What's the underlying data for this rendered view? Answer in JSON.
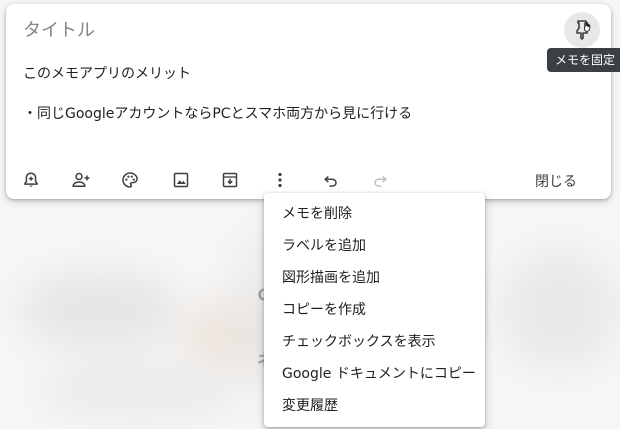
{
  "note": {
    "title_placeholder": "タイトル",
    "body_lines": [
      "このメモアプリのメリット",
      "・同じGoogleアカウントならPCとスマホ両方から見に行ける"
    ]
  },
  "pin": {
    "icon": "pin-icon",
    "tooltip": "メモを固定"
  },
  "toolbar": {
    "icons": [
      "remind-me-icon",
      "collaborator-icon",
      "palette-icon",
      "image-icon",
      "archive-icon",
      "more-vert-icon",
      "undo-icon",
      "redo-icon"
    ],
    "close_label": "閉じる"
  },
  "menu": {
    "items": [
      "メモを削除",
      "ラベルを追加",
      "図形描画を追加",
      "コピーを作成",
      "チェックボックスを表示",
      "Google ドキュメントにコピー",
      "変更履歴"
    ]
  },
  "background": {
    "partial_chars": [
      "C",
      "ネ"
    ]
  },
  "colors": {
    "icon": "#3c4043",
    "icon_disabled": "#bdc1c6",
    "tooltip_bg": "#3c4043",
    "placeholder": "#80868b"
  }
}
